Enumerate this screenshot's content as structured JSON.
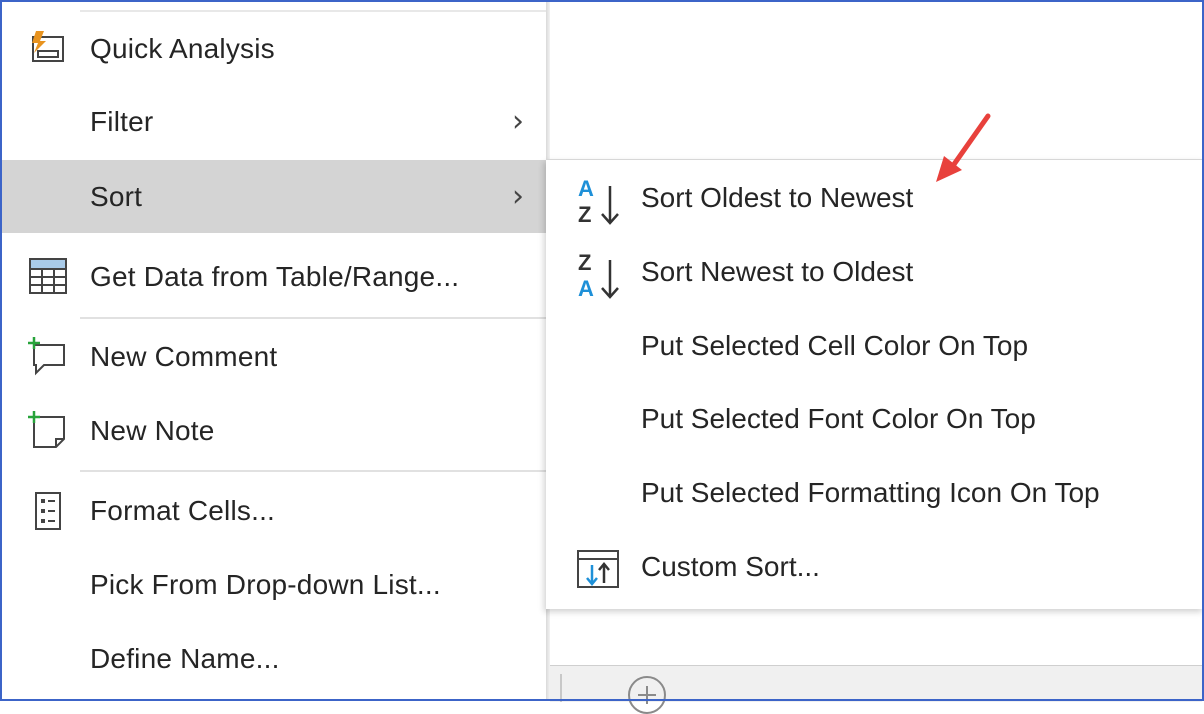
{
  "menu": {
    "items": [
      {
        "id": "quick-analysis",
        "label": "Quick Analysis",
        "icon": "quick-analysis-icon"
      },
      {
        "id": "filter",
        "label": "Filter",
        "submenu": true
      },
      {
        "id": "sort",
        "label": "Sort",
        "submenu": true,
        "highlighted": true
      },
      {
        "id": "get-data",
        "label": "Get Data from Table/Range...",
        "icon": "table-icon"
      },
      {
        "id": "new-comment",
        "label": "New Comment",
        "icon": "new-comment-icon"
      },
      {
        "id": "new-note",
        "label": "New Note",
        "icon": "new-note-icon"
      },
      {
        "id": "format-cells",
        "label": "Format Cells...",
        "icon": "format-cells-icon"
      },
      {
        "id": "pick-list",
        "label": "Pick From Drop-down List..."
      },
      {
        "id": "define-name",
        "label": "Define Name..."
      }
    ]
  },
  "submenu": {
    "items": [
      {
        "label": "Sort Oldest to Newest",
        "icon": "sort-a-z-icon"
      },
      {
        "label": "Sort Newest to Oldest",
        "icon": "sort-z-a-icon"
      },
      {
        "label": "Put Selected Cell Color On Top"
      },
      {
        "label": "Put Selected Font Color On Top"
      },
      {
        "label": "Put Selected Formatting Icon On Top"
      },
      {
        "label": "Custom Sort...",
        "icon": "custom-sort-icon"
      }
    ]
  },
  "colors": {
    "highlight": "#d4d4d4",
    "accent_blue": "#1e90d8",
    "annotation_red": "#e8413c",
    "frame": "#3c64c8"
  }
}
